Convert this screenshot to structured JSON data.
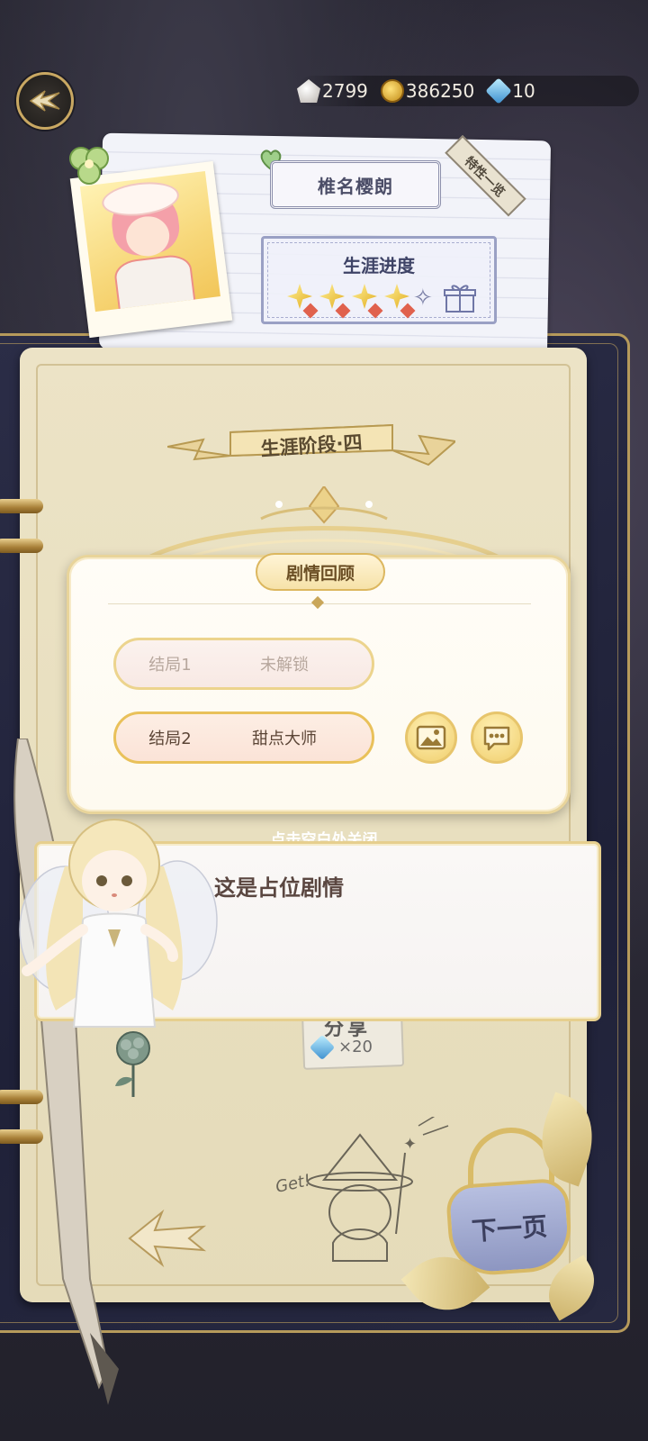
{
  "currencies": [
    {
      "icon": "shell-icon",
      "value": "2799"
    },
    {
      "icon": "coin-icon",
      "value": "386250"
    },
    {
      "icon": "gem-icon",
      "value": "10"
    }
  ],
  "profile": {
    "character_name": "椎名樱朗",
    "traits_tab": "特性一览",
    "career_progress_label": "生涯进度",
    "stars_filled": 4,
    "stars_total": 5
  },
  "stage": {
    "label": "生涯阶段·四"
  },
  "review": {
    "title": "剧情回顾",
    "endings": [
      {
        "number": "结局1",
        "title": "未解锁",
        "unlocked": false
      },
      {
        "number": "结局2",
        "title": "甜点大师",
        "unlocked": true
      }
    ],
    "close_hint": "点击空白处关闭"
  },
  "dialog": {
    "text": "这是占位剧情"
  },
  "share": {
    "label": "分享",
    "reward": "×20"
  },
  "doodle_text": "Get!",
  "next_page_label": "下一页",
  "colors": {
    "gold_border": "#e6cf8e",
    "panel_bg": "#fffdf7",
    "navy_panel": "#1f2138"
  }
}
